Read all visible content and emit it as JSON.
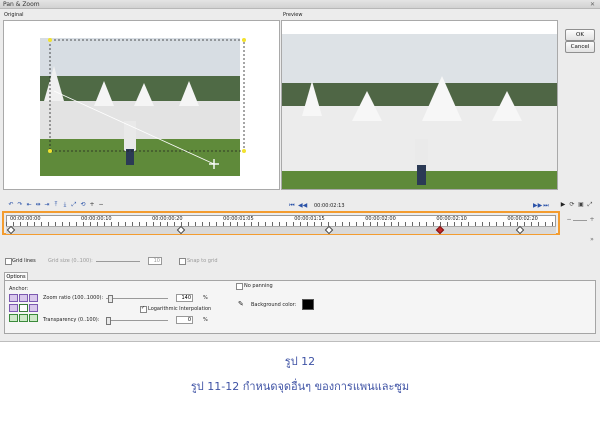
{
  "window": {
    "title": "Pan & Zoom",
    "close_glyph": "✕"
  },
  "panels": {
    "original_label": "Original",
    "preview_label": "Preview"
  },
  "buttons": {
    "ok": "OK",
    "cancel": "Cancel"
  },
  "preview_controls": {
    "timecode": "00:00:02:13",
    "prev": "⏮",
    "back": "◀◀",
    "fwd": "▶▶",
    "next": "⏭"
  },
  "timeline": {
    "labels": [
      "00:00:00:00",
      "00:00:00:10",
      "00:00:00:20",
      "00:00:01:05",
      "00:00:01:15",
      "00:00:02:00",
      "00:00:02:10",
      "00:00:02:20"
    ],
    "keyframes": [
      0.0,
      0.32,
      0.6,
      0.81,
      0.96
    ],
    "selected_keyframe": 3
  },
  "grid": {
    "grid_lines": "Grid lines",
    "grid_size": "Grid size (0..100):",
    "grid_size_value": "10",
    "snap": "Snap to grid"
  },
  "options": {
    "tab": "Options",
    "anchor": "Anchor:",
    "zoom_label": "Zoom ratio (100..1000):",
    "zoom_value": "140",
    "zoom_unit": "%",
    "log_interp": "Logarithmic Interpolation",
    "transparency_label": "Transparency (0..100):",
    "transparency_value": "0",
    "transparency_unit": "%",
    "no_panning": "No panning",
    "background_color": "Background color:",
    "background_hex": "#000000"
  },
  "captions": {
    "figure": "รูป 12",
    "subtitle": "รูป 11-12 กำหนดจุดอื่นๆ ของการแพนและซูม"
  },
  "colors": {
    "accent_frame": "#f39c2f",
    "caption": "#3f53a5",
    "keyframe_selected": "#c62828"
  }
}
